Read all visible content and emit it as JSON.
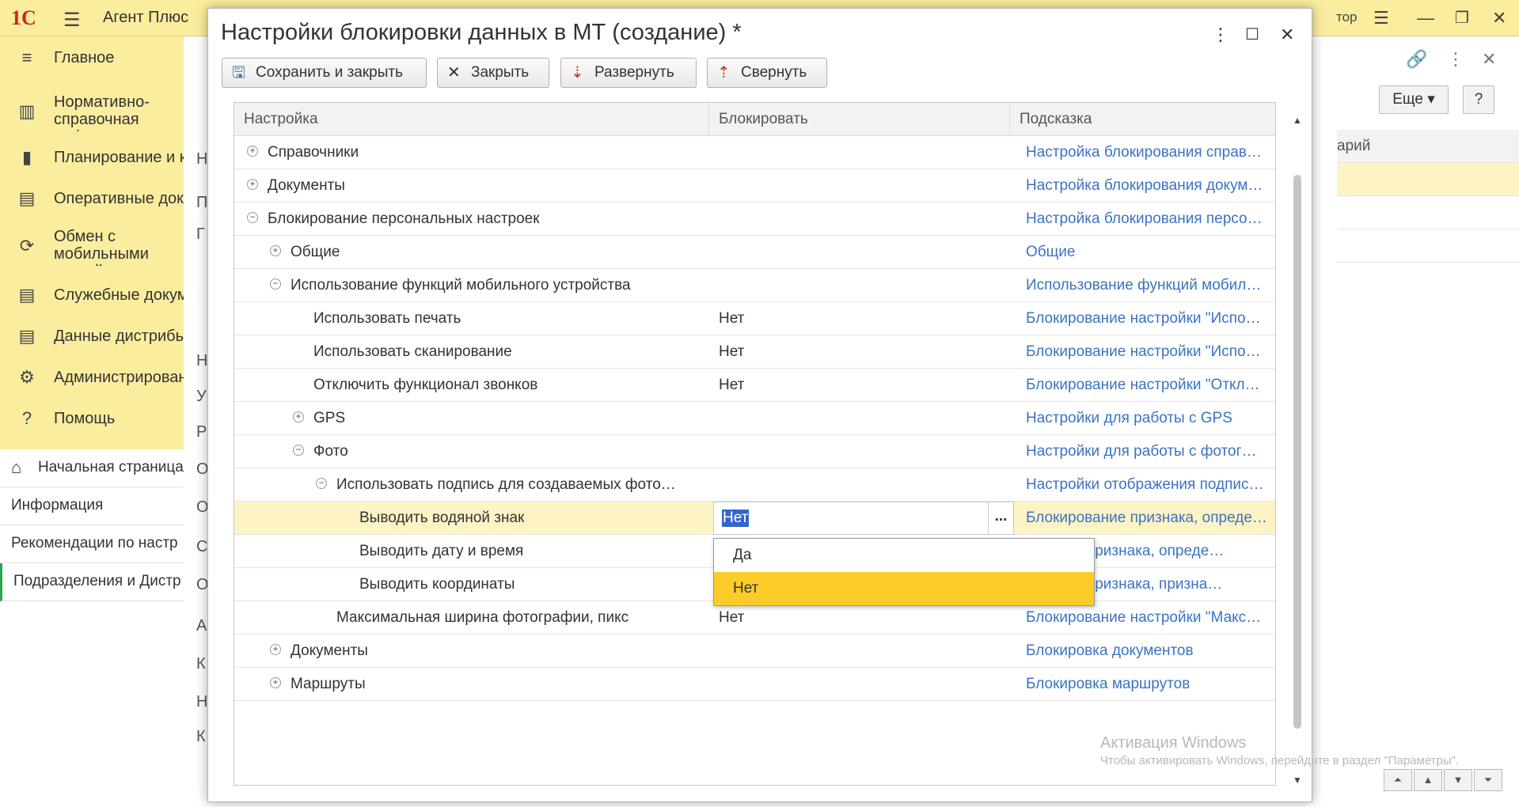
{
  "app": {
    "logo": "1С",
    "title": "Агент Плюс",
    "top_right_text": "тор"
  },
  "sidebar": {
    "items": [
      {
        "icon": "≡",
        "label": "Главное"
      },
      {
        "icon": "▥",
        "label": "Нормативно-справочная информация"
      },
      {
        "icon": "▮",
        "label": "Планирование и к"
      },
      {
        "icon": "▤",
        "label": "Оперативные док"
      },
      {
        "icon": "⟳",
        "label": "Обмен с мобильными устройствами"
      },
      {
        "icon": "▤",
        "label": "Служебные докум"
      },
      {
        "icon": "▤",
        "label": "Данные дистрибь"
      },
      {
        "icon": "⚙",
        "label": "Администрирован"
      },
      {
        "icon": "?",
        "label": "Помощь"
      }
    ]
  },
  "panel": {
    "items": [
      {
        "label": "Начальная страница"
      },
      {
        "label": "Информация"
      },
      {
        "label": "Рекомендации по настр"
      },
      {
        "label": "Подразделения и Дистр"
      }
    ]
  },
  "background": {
    "more_button": "Еще",
    "help_button": "?",
    "right_header": "арий",
    "mid_letters": [
      "Н",
      "П",
      "Г",
      "Н",
      "У",
      "Р",
      "О",
      "О",
      "С",
      "О",
      "А",
      "К",
      "Н",
      "К"
    ]
  },
  "modal": {
    "title": "Настройки блокировки данных в МТ (создание) *",
    "toolbar": {
      "save_close": "Сохранить и закрыть",
      "close": "Закрыть",
      "expand": "Развернуть",
      "collapse": "Свернуть"
    },
    "columns": {
      "setting": "Настройка",
      "block": "Блокировать",
      "hint": "Подсказка"
    },
    "rows": [
      {
        "name": "Справочники",
        "value": "",
        "hint": "Настройка блокирования справ…"
      },
      {
        "name": "Документы",
        "value": "",
        "hint": "Настройка блокирования докум…"
      },
      {
        "name": "Блокирование персональных настроек",
        "value": "",
        "hint": "Настройка блокирования персо…"
      },
      {
        "name": "Общие",
        "value": "",
        "hint": "Общие"
      },
      {
        "name": "Использование функций мобильного устройства",
        "value": "",
        "hint": "Использование функций мобил…"
      },
      {
        "name": "Использовать печать",
        "value": "Нет",
        "hint": "Блокирование настройки \"Испо…"
      },
      {
        "name": "Использовать сканирование",
        "value": "Нет",
        "hint": "Блокирование настройки \"Испо…"
      },
      {
        "name": "Отключить функционал звонков",
        "value": "Нет",
        "hint": "Блокирование настройки \"Откл…"
      },
      {
        "name": "GPS",
        "value": "",
        "hint": "Настройки для работы с GPS"
      },
      {
        "name": "Фото",
        "value": "",
        "hint": "Настройки для работы с фотог…"
      },
      {
        "name": "Использовать подпись для создаваемых фото…",
        "value": "",
        "hint": "Настройки отображения подпис…"
      },
      {
        "name": "Выводить водяной знак",
        "value": "Нет",
        "hint": "Блокирование признака, опреде…"
      },
      {
        "name": "Выводить дату и время",
        "value": "",
        "hint": "ние признака, опреде…"
      },
      {
        "name": "Выводить координаты",
        "value": "",
        "hint": "ние признака, призна…"
      },
      {
        "name": "Максимальная ширина фотографии, пикс",
        "value": "Нет",
        "hint": "Блокирование настройки \"Макс…"
      },
      {
        "name": "Документы",
        "value": "",
        "hint": "Блокировка документов"
      },
      {
        "name": "Маршруты",
        "value": "",
        "hint": "Блокировка маршрутов"
      }
    ],
    "edit_button": "...",
    "dropdown": [
      "Да",
      "Нет"
    ]
  },
  "watermark": {
    "line1": "Активация Windows",
    "line2": "Чтобы активировать Windows, перейдите в раздел \"Параметры\"."
  },
  "colors": {
    "accent_yellow": "#fbed9e",
    "selected_option": "#fccd29",
    "hint_link": "#3a73c4",
    "selected_row": "#fdf3c5"
  }
}
